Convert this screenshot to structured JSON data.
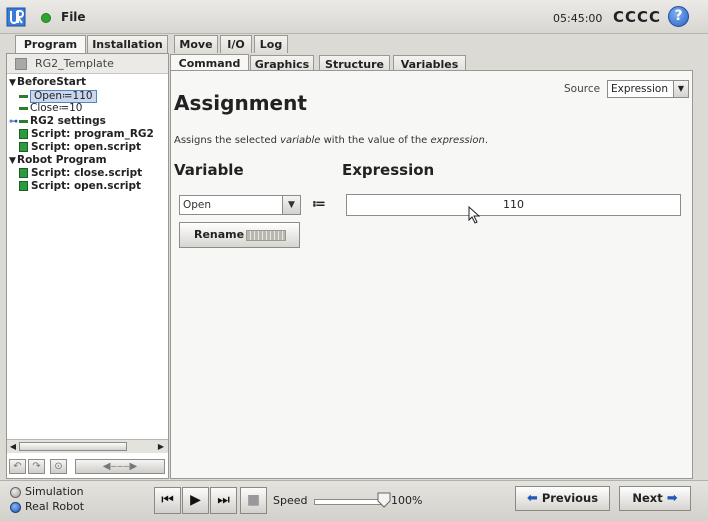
{
  "header": {
    "menu_label": "File",
    "clock": "05:45:00",
    "robot_name": "CCCC",
    "help_glyph": "?",
    "icons": [
      "ur-logo-icon",
      "status-dot-icon",
      "help-icon"
    ],
    "status_color": "#2fa52f"
  },
  "main_tabs": [
    {
      "label": "Program",
      "active": true
    },
    {
      "label": "Installation",
      "active": false
    },
    {
      "label": "Move",
      "active": false
    },
    {
      "label": "I/O",
      "active": false
    },
    {
      "label": "Log",
      "active": false
    }
  ],
  "sub_tabs": [
    {
      "label": "Command",
      "active": true
    },
    {
      "label": "Graphics",
      "active": false
    },
    {
      "label": "Structure",
      "active": false
    },
    {
      "label": "Variables",
      "active": false
    }
  ],
  "program": {
    "name": "RG2_Template",
    "tree": [
      {
        "label": "BeforeStart"
      },
      {
        "label": "Open≔110",
        "selected": true
      },
      {
        "label": "Close≔10"
      },
      {
        "label": "RG2 settings"
      },
      {
        "label": "Script: program_RG2"
      },
      {
        "label": "Script: open.script"
      },
      {
        "label": "Robot Program"
      },
      {
        "label": "Script: close.script"
      },
      {
        "label": "Script: open.script"
      }
    ]
  },
  "command": {
    "title": "Assignment",
    "source_label": "Source",
    "source_value": "Expression",
    "description_pre": "Assigns the selected ",
    "description_var": "variable",
    "description_mid": " with the value of the ",
    "description_expr": "expression",
    "description_post": ".",
    "variable_heading": "Variable",
    "expression_heading": "Expression",
    "variable_value": "Open",
    "assign_operator": "≔",
    "expression_value": "110",
    "rename_label": "Rename"
  },
  "footer": {
    "simulation_label": "Simulation",
    "real_robot_label": "Real Robot",
    "speed_label": "Speed",
    "speed_value": "100%",
    "speed_fraction": 1.0,
    "previous_label": "Previous",
    "next_label": "Next",
    "mode": "Real Robot",
    "accent_color": "#1e58b8"
  }
}
